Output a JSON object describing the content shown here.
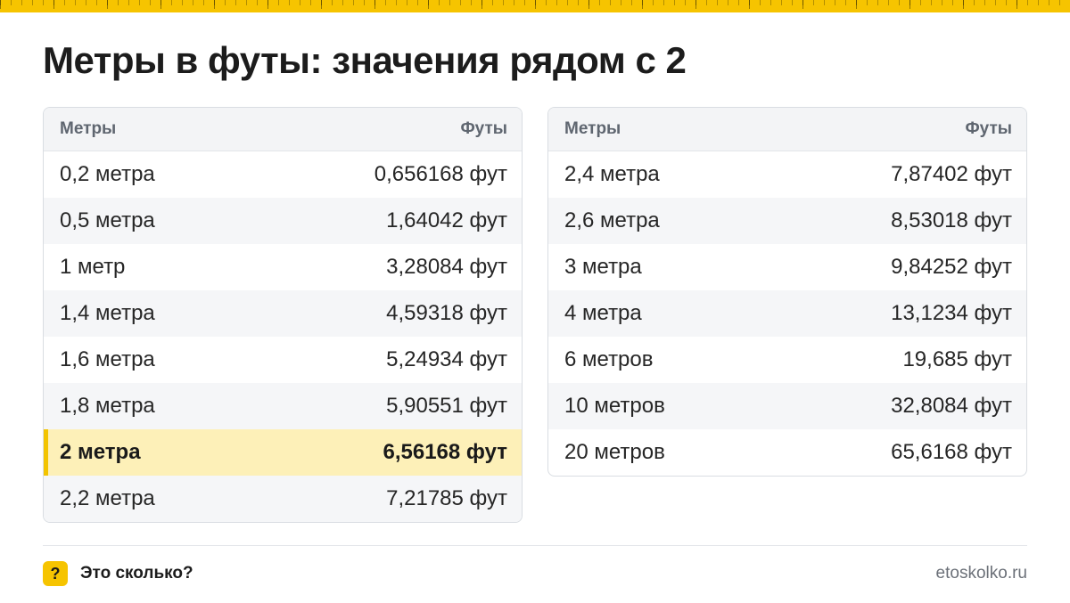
{
  "title": "Метры в футы: значения рядом с 2",
  "tables": {
    "left": {
      "header": {
        "col1": "Метры",
        "col2": "Футы"
      },
      "rows": [
        {
          "meters": "0,2 метра",
          "feet": "0,656168 фут"
        },
        {
          "meters": "0,5 метра",
          "feet": "1,64042 фут"
        },
        {
          "meters": "1 метр",
          "feet": "3,28084 фут"
        },
        {
          "meters": "1,4 метра",
          "feet": "4,59318 фут"
        },
        {
          "meters": "1,6 метра",
          "feet": "5,24934 фут"
        },
        {
          "meters": "1,8 метра",
          "feet": "5,90551 фут"
        },
        {
          "meters": "2 метра",
          "feet": "6,56168 фут",
          "highlighted": true
        },
        {
          "meters": "2,2 метра",
          "feet": "7,21785 фут"
        }
      ]
    },
    "right": {
      "header": {
        "col1": "Метры",
        "col2": "Футы"
      },
      "rows": [
        {
          "meters": "2,4 метра",
          "feet": "7,87402 фут"
        },
        {
          "meters": "2,6 метра",
          "feet": "8,53018 фут"
        },
        {
          "meters": "3 метра",
          "feet": "9,84252 фут"
        },
        {
          "meters": "4 метра",
          "feet": "13,1234 фут"
        },
        {
          "meters": "6 метров",
          "feet": "19,685 фут"
        },
        {
          "meters": "10 метров",
          "feet": "32,8084 фут"
        },
        {
          "meters": "20 метров",
          "feet": "65,6168 фут"
        }
      ]
    }
  },
  "footer": {
    "brand_icon": "?",
    "brand_name": "Это сколько?",
    "site": "etoskolko.ru"
  },
  "colors": {
    "accent": "#f6c400",
    "highlight_row": "#fdf0b8",
    "header_bg": "#f3f4f6",
    "alt_row": "#f5f6f8"
  },
  "icons": {
    "brand": "question-mark-icon",
    "top_decoration": "ruler-strip"
  }
}
